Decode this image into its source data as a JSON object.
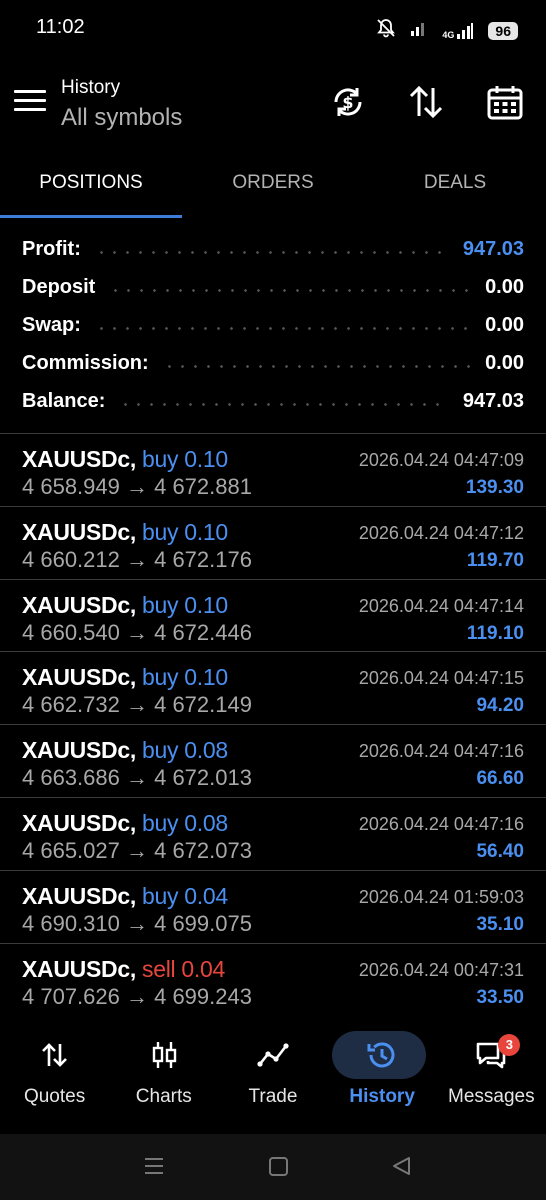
{
  "status_bar": {
    "time": "11:02",
    "network": "4G",
    "battery": "96"
  },
  "toolbar": {
    "title": "History",
    "subtitle": "All symbols",
    "icons": [
      "menu-icon",
      "sync-money-icon",
      "sort-icon",
      "calendar-icon"
    ]
  },
  "tabs": [
    {
      "label": "POSITIONS",
      "active": true
    },
    {
      "label": "ORDERS",
      "active": false
    },
    {
      "label": "DEALS",
      "active": false
    }
  ],
  "summary": {
    "profit_label": "Profit:",
    "profit_value": "947.03",
    "deposit_label": "Deposit",
    "deposit_value": "0.00",
    "swap_label": "Swap:",
    "swap_value": "0.00",
    "commission_label": "Commission:",
    "commission_value": "0.00",
    "balance_label": "Balance:",
    "balance_value": "947.03"
  },
  "positions": [
    {
      "symbol": "XAUUSDc,",
      "side": "buy 0.10",
      "prices": "4 658.949 → 4 672.881",
      "time": "2026.04.24 04:47:09",
      "profit": "139.30"
    },
    {
      "symbol": "XAUUSDc,",
      "side": "buy 0.10",
      "prices": "4 660.212 → 4 672.176",
      "time": "2026.04.24 04:47:12",
      "profit": "119.70"
    },
    {
      "symbol": "XAUUSDc,",
      "side": "buy 0.10",
      "prices": "4 660.540 → 4 672.446",
      "time": "2026.04.24 04:47:14",
      "profit": "119.10"
    },
    {
      "symbol": "XAUUSDc,",
      "side": "buy 0.10",
      "prices": "4 662.732 → 4 672.149",
      "time": "2026.04.24 04:47:15",
      "profit": "94.20"
    },
    {
      "symbol": "XAUUSDc,",
      "side": "buy 0.08",
      "prices": "4 663.686 → 4 672.013",
      "time": "2026.04.24 04:47:16",
      "profit": "66.60"
    },
    {
      "symbol": "XAUUSDc,",
      "side": "buy 0.08",
      "prices": "4 665.027 → 4 672.073",
      "time": "2026.04.24 04:47:16",
      "profit": "56.40"
    },
    {
      "symbol": "XAUUSDc,",
      "side": "buy 0.04",
      "prices": "4 690.310 → 4 699.075",
      "time": "2026.04.24 01:59:03",
      "profit": "35.10"
    },
    {
      "symbol": "XAUUSDc,",
      "side": "sell 0.04",
      "prices": "4 707.626 → 4 699.243",
      "time": "2026.04.24 00:47:31",
      "profit": "33.50"
    }
  ],
  "bottom_nav": [
    {
      "label": "Quotes",
      "icon": "quotes-arrows-icon",
      "active": false
    },
    {
      "label": "Charts",
      "icon": "candlestick-icon",
      "active": false
    },
    {
      "label": "Trade",
      "icon": "trend-line-icon",
      "active": false
    },
    {
      "label": "History",
      "icon": "history-clock-icon",
      "active": true
    },
    {
      "label": "Messages",
      "icon": "chat-icon",
      "active": false,
      "badge": "3"
    }
  ],
  "colors": {
    "accent_blue": "#4b8ff0",
    "sell_red": "#e8453c",
    "tab_underline": "#3b7dd8",
    "active_pill": "#1e2c44"
  }
}
